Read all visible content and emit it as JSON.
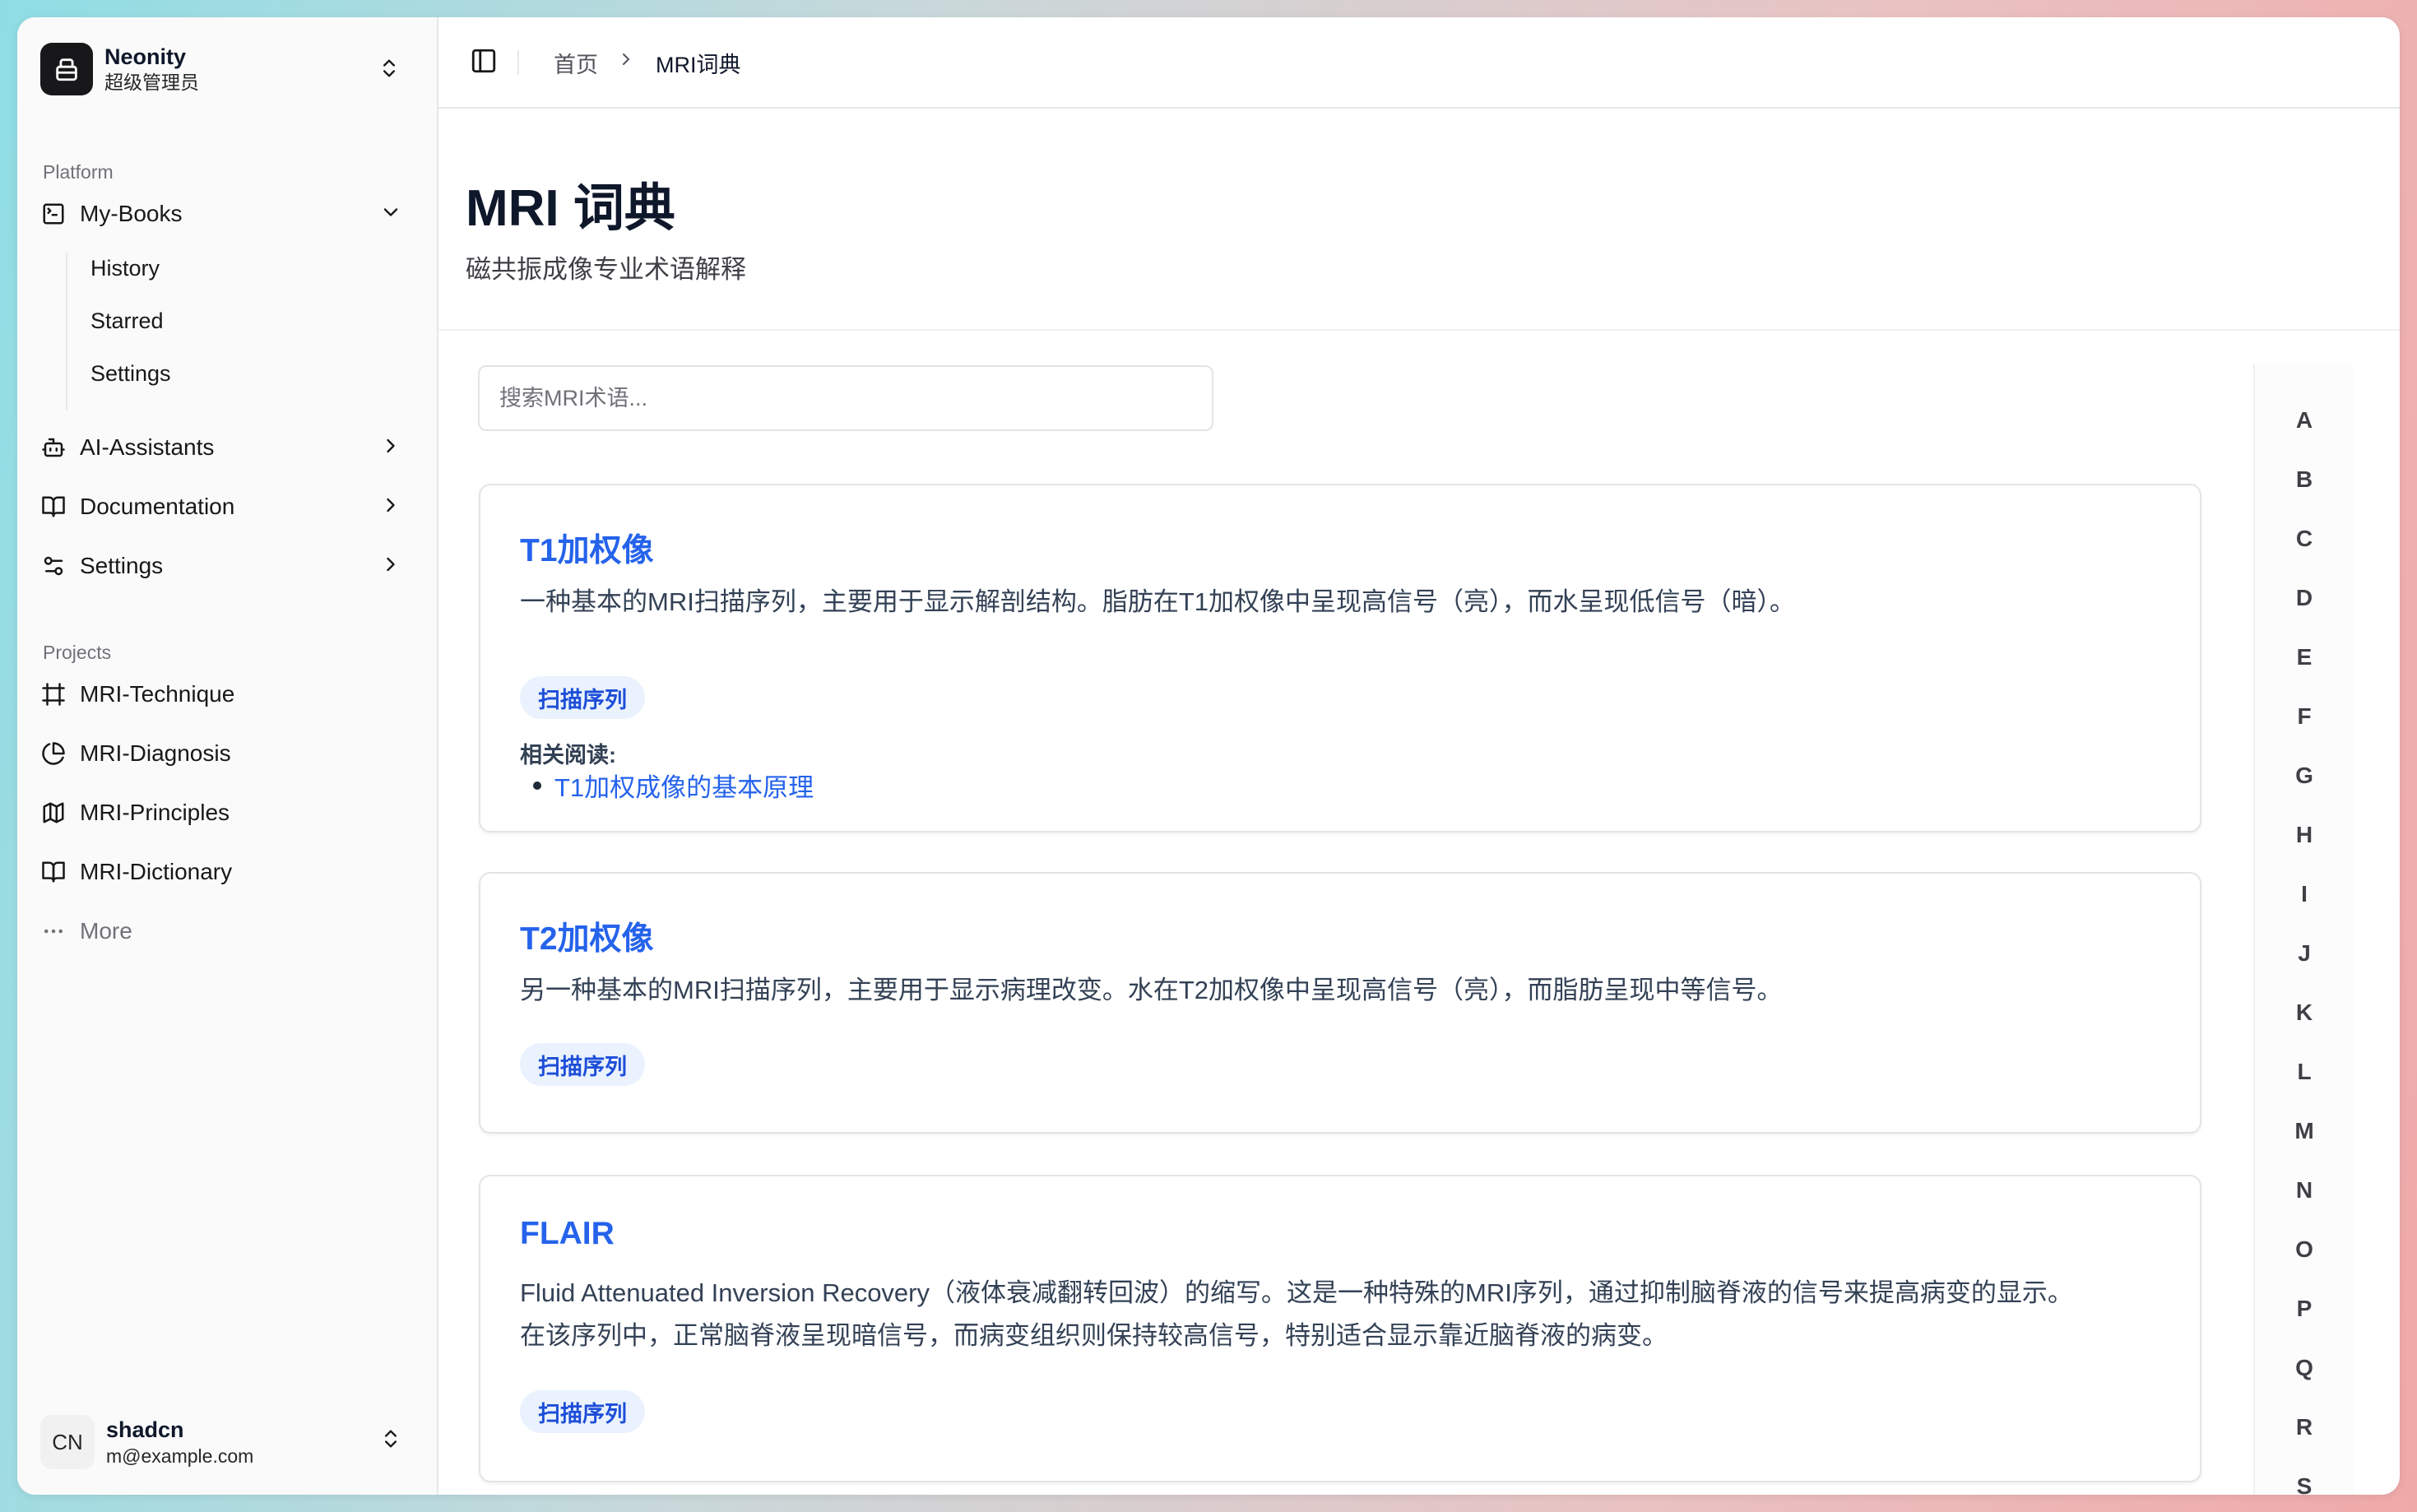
{
  "team": {
    "name": "Neonity",
    "role": "超级管理员"
  },
  "sidebar": {
    "platform_label": "Platform",
    "platform_items": [
      {
        "label": "My-Books",
        "icon": "terminal-square-icon",
        "expanded": true,
        "children": [
          "History",
          "Starred",
          "Settings"
        ]
      },
      {
        "label": "AI-Assistants",
        "icon": "bot-icon"
      },
      {
        "label": "Documentation",
        "icon": "book-open-icon"
      },
      {
        "label": "Settings",
        "icon": "sliders-icon"
      }
    ],
    "projects_label": "Projects",
    "project_items": [
      {
        "label": "MRI-Technique",
        "icon": "frame-icon"
      },
      {
        "label": "MRI-Diagnosis",
        "icon": "pie-chart-icon"
      },
      {
        "label": "MRI-Principles",
        "icon": "map-icon"
      },
      {
        "label": "MRI-Dictionary",
        "icon": "book-icon"
      }
    ],
    "more_label": "More"
  },
  "user": {
    "initials": "CN",
    "name": "shadcn",
    "email": "m@example.com"
  },
  "breadcrumb": {
    "home": "首页",
    "current": "MRI词典"
  },
  "page": {
    "title": "MRI 词典",
    "subtitle": "磁共振成像专业术语解释"
  },
  "search": {
    "placeholder": "搜索MRI术语...",
    "value": ""
  },
  "entries": [
    {
      "title": "T1加权像",
      "description": "一种基本的MRI扫描序列，主要用于显示解剖结构。脂肪在T1加权像中呈现高信号（亮），而水呈现低信号（暗）。",
      "tag": "扫描序列",
      "related_label": "相关阅读:",
      "related": [
        "T1加权成像的基本原理"
      ]
    },
    {
      "title": "T2加权像",
      "description": "另一种基本的MRI扫描序列，主要用于显示病理改变。水在T2加权像中呈现高信号（亮），而脂肪呈现中等信号。",
      "tag": "扫描序列"
    },
    {
      "title": "FLAIR",
      "description_lines": [
        "Fluid Attenuated Inversion Recovery（液体衰减翻转回波）的缩写。这是一种特殊的MRI序列，通过抑制脑脊液的信号来提高病变的显示。",
        "在该序列中，正常脑脊液呈现暗信号，而病变组织则保持较高信号，特别适合显示靠近脑脊液的病变。"
      ],
      "tag": "扫描序列"
    }
  ],
  "alphabet": [
    "A",
    "B",
    "C",
    "D",
    "E",
    "F",
    "G",
    "H",
    "I",
    "J",
    "K",
    "L",
    "M",
    "N",
    "O",
    "P",
    "Q",
    "R",
    "S"
  ],
  "colors": {
    "link": "#2563eb",
    "tag_bg": "#eaf2fe",
    "tag_text": "#1d4ed8",
    "logo_bg": "#18181b"
  }
}
